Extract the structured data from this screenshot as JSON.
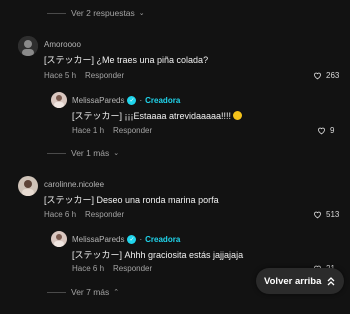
{
  "replies_toggle_top": {
    "label": "Ver 2 respuestas"
  },
  "comments": [
    {
      "username": "Amoroooo",
      "text": "[ステッカー] ¿Me traes una piña colada?",
      "time": "Hace 5 h",
      "reply_label": "Responder",
      "likes": "263",
      "reply": {
        "username": "MelissaPareds",
        "badge": "Creadora",
        "text": "[ステッカー] ¡¡¡Estaaaa atrevidaaaaa!!!!",
        "time": "Hace 1 h",
        "reply_label": "Responder",
        "likes": "9"
      },
      "toggle_label": "Ver 1 más"
    },
    {
      "username": "carolinne.nicolee",
      "text": "[ステッカー] Deseo una ronda marina porfa",
      "time": "Hace 6 h",
      "reply_label": "Responder",
      "likes": "513",
      "reply": {
        "username": "MelissaPareds",
        "badge": "Creadora",
        "text": "[ステッカー] Ahhh graciosita estás jajjajaja",
        "time": "Hace 6 h",
        "reply_label": "Responder",
        "likes": "21"
      },
      "toggle_label": "Ver 7 más"
    }
  ],
  "back_to_top": {
    "label": "Volver arriba"
  },
  "icons": {
    "heart": "heart-outline-icon",
    "chevron_down": "chevron-down-icon",
    "chevron_up": "chevron-up-icon",
    "verified": "verified-check-icon"
  },
  "colors": {
    "background": "#121212",
    "accent": "#20d5ec"
  }
}
